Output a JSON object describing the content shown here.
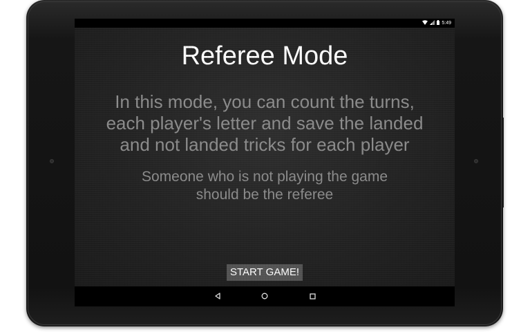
{
  "status_bar": {
    "time": "5:49",
    "icons": [
      "wifi-icon",
      "signal-icon",
      "battery-icon"
    ]
  },
  "screen": {
    "title": "Referee Mode",
    "description_lines": [
      "In this mode, you can count the turns,",
      "each player's letter and save the landed",
      "and not landed tricks for each player"
    ],
    "note_lines": [
      "Someone who is not playing the game",
      "should be the referee"
    ],
    "start_button_label": "START GAME!"
  },
  "pager": {
    "page_count": 3,
    "active_index": 0,
    "colors": {
      "active": "#1e9fc4",
      "inactive": "#bdbdbd"
    }
  },
  "nav_bar": {
    "buttons": [
      "back-icon",
      "home-icon",
      "recents-icon"
    ]
  },
  "colors": {
    "title": "#ffffff",
    "body_text": "#8c8c8c",
    "button_bg": "#545454",
    "accent": "#1e9fc4"
  }
}
